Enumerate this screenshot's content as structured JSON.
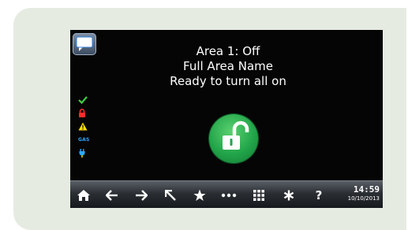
{
  "status": {
    "line1": "Area 1: Off",
    "line2": "Full Area Name",
    "line3": "Ready to turn all on"
  },
  "status_icons": [
    {
      "name": "check-icon",
      "color": "#3fcf45"
    },
    {
      "name": "lock-icon",
      "color": "#ff2b2b"
    },
    {
      "name": "warning-icon",
      "color": "#ffe000"
    },
    {
      "name": "gas-icon",
      "label": "GAS",
      "color": "#2ea7ff"
    },
    {
      "name": "plug-icon",
      "color": "#2ea7ff"
    }
  ],
  "main_action": {
    "icon": "unlocked-padlock-icon",
    "color": "#22a54a"
  },
  "toolbar": {
    "buttons": [
      {
        "name": "home-icon"
      },
      {
        "name": "arrow-left-icon"
      },
      {
        "name": "arrow-right-icon"
      },
      {
        "name": "arrow-up-left-icon"
      },
      {
        "name": "star-icon"
      },
      {
        "name": "more-icon"
      },
      {
        "name": "keypad-icon"
      },
      {
        "name": "asterisk-icon"
      },
      {
        "name": "help-icon",
        "label": "?"
      }
    ],
    "time": "14:59",
    "date": "10/10/2013"
  }
}
